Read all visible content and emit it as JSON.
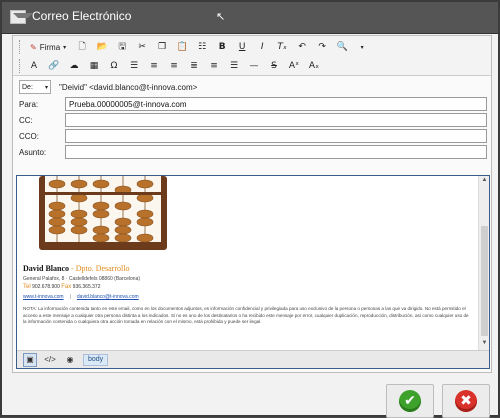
{
  "window": {
    "title": "Correo Electrónico"
  },
  "toolbar": {
    "firma_label": "Firma",
    "icons_row1": [
      "new-document-icon",
      "open-folder-icon",
      "save-icon",
      "cut-icon",
      "copy-icon",
      "paste-icon",
      "paste-text-icon",
      "bold-icon",
      "underline-icon",
      "italic-icon",
      "remove-format-icon",
      "undo-icon",
      "redo-icon",
      "find-icon"
    ],
    "icons_row2": [
      "font-icon",
      "link-icon",
      "unlink-icon",
      "table-icon",
      "special-char-icon",
      "numbered-list-icon",
      "bulleted-list-icon",
      "align-left-icon",
      "align-center-icon",
      "align-right-icon",
      "justify-icon",
      "horizontal-rule-icon",
      "strikethrough-icon",
      "superscript-icon",
      "subscript-icon"
    ]
  },
  "from": {
    "select_label": "De:",
    "value": "\"Deivid\" <david.blanco@t-innova.com>"
  },
  "fields": {
    "para_label": "Para:",
    "para_value": "Prueba.00000005@t-innova.com",
    "cc_label": "CC:",
    "cc_value": "",
    "cco_label": "CCO:",
    "cco_value": "",
    "asunto_label": "Asunto:",
    "asunto_value": ""
  },
  "signature": {
    "name": "David Blanco",
    "separator": " - ",
    "department": "Dpto. Desarrollo",
    "address": "General Palafox, 8 · Castelldefels 08860 (Barcelona)",
    "tel_label": "Tel",
    "tel_value": "902.678.900",
    "fax_label": "Fax",
    "fax_value": "936.365.372",
    "website": "www.t-innova.com",
    "email": "david.blanco@t-innova.com"
  },
  "nota": "NOTA: La información contenida tanto en este email, como en los documentos adjuntos, es información confidencial y privilegiada para uso exclusivo de la persona o personas a las que va dirigido. No está permitido el acceso a este mensaje a cualquier otra persona distinta a los indicados. Si no es uno de los destinatarios o ha recibido este mensaje por error, cualquier duplicación, reproducción, distribución, así como cualquier uso de la información contenida o cualquiera otra acción tomada en relación con el mismo, está prohibida y puede ser ilegal.",
  "statusbar": {
    "path_tag": "body"
  },
  "colors": {
    "accent_orange": "#e08a1c",
    "link_blue": "#1e4fb0",
    "ok_green": "#3ea12b",
    "cancel_red": "#d8322a"
  }
}
